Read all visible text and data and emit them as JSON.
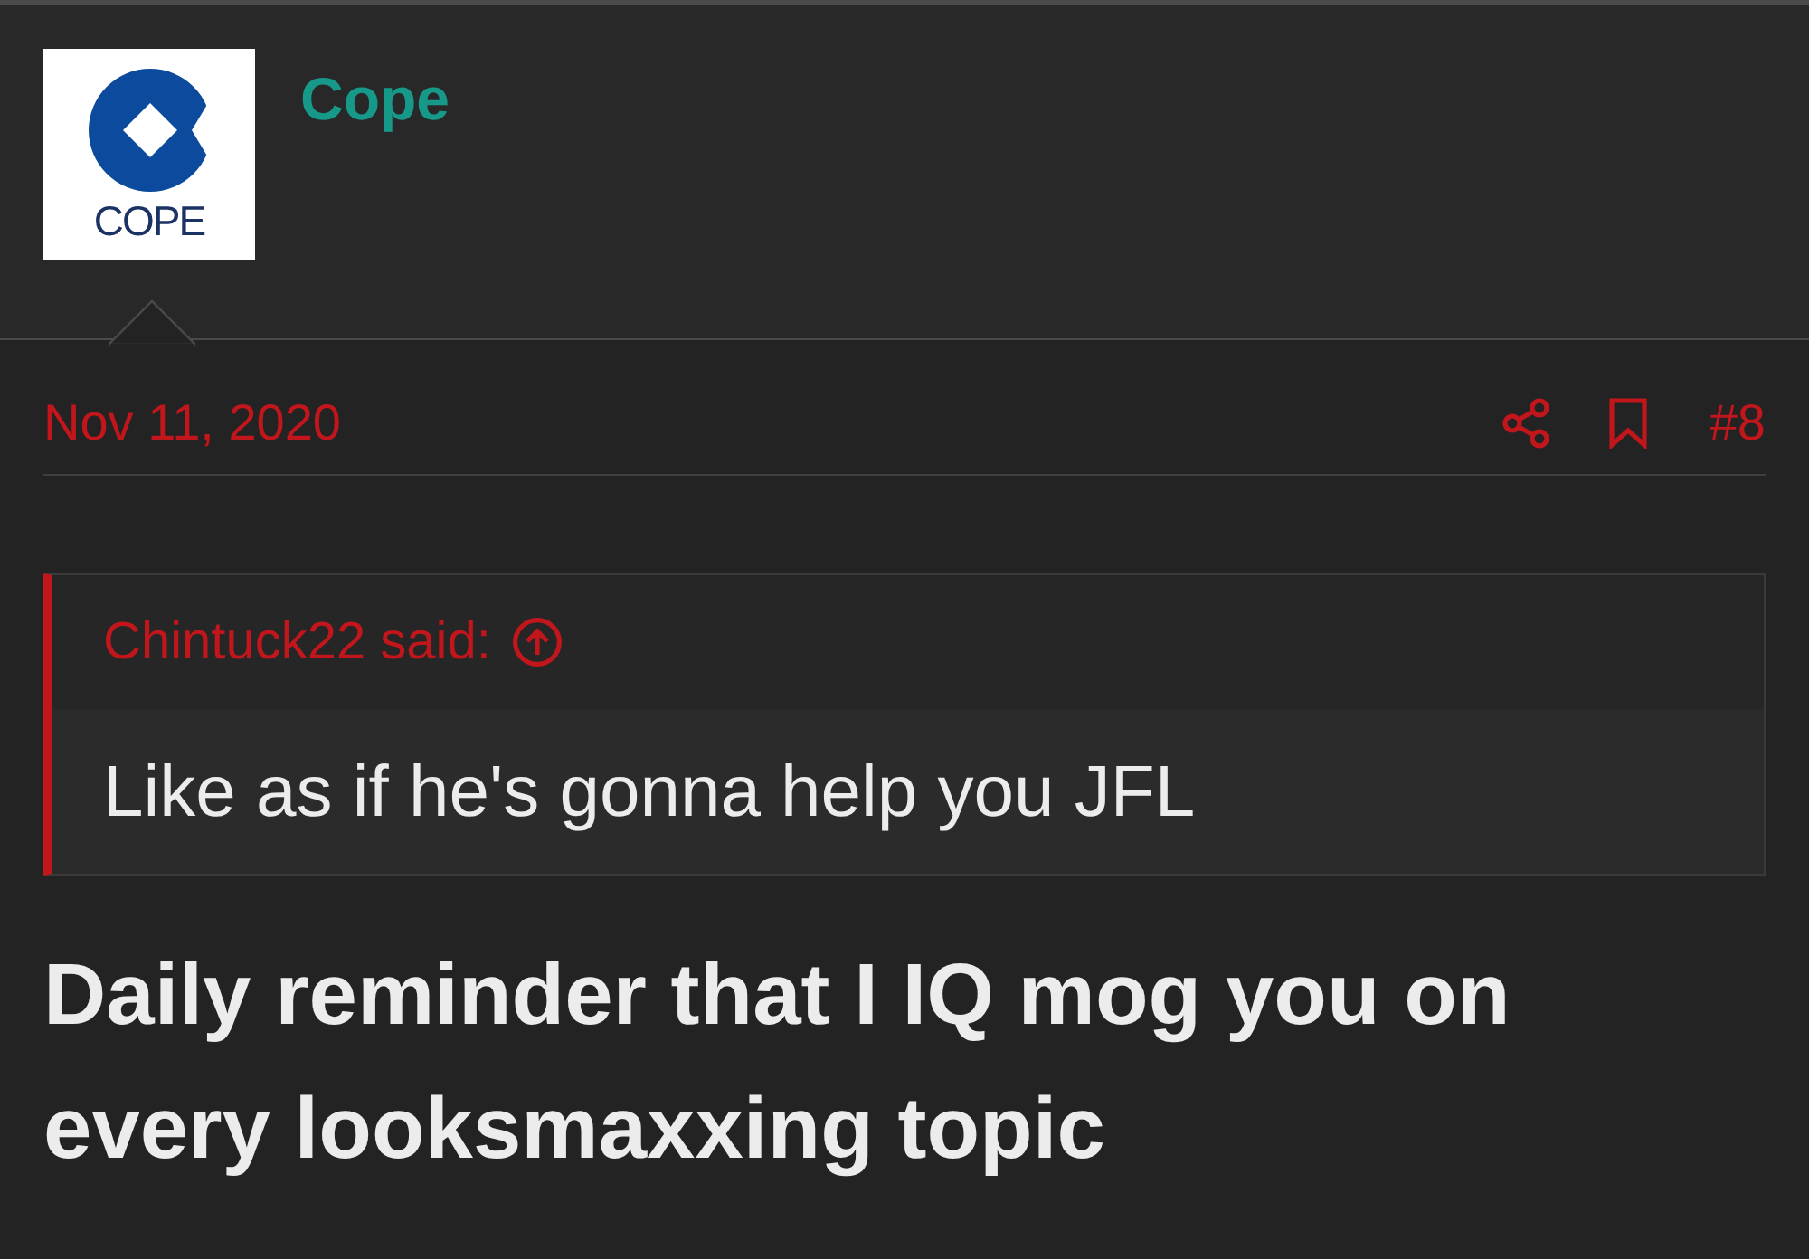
{
  "post_header": {
    "avatar": {
      "logo_text": "COPE"
    },
    "username": "Cope"
  },
  "post_meta": {
    "date": "Nov 11, 2020",
    "post_number": "#8"
  },
  "quote": {
    "attribution": "Chintuck22 said:",
    "text": "Like as if he's gonna help you JFL"
  },
  "body": {
    "text": "Daily reminder that I IQ mog you on every looksmaxxing topic"
  }
}
